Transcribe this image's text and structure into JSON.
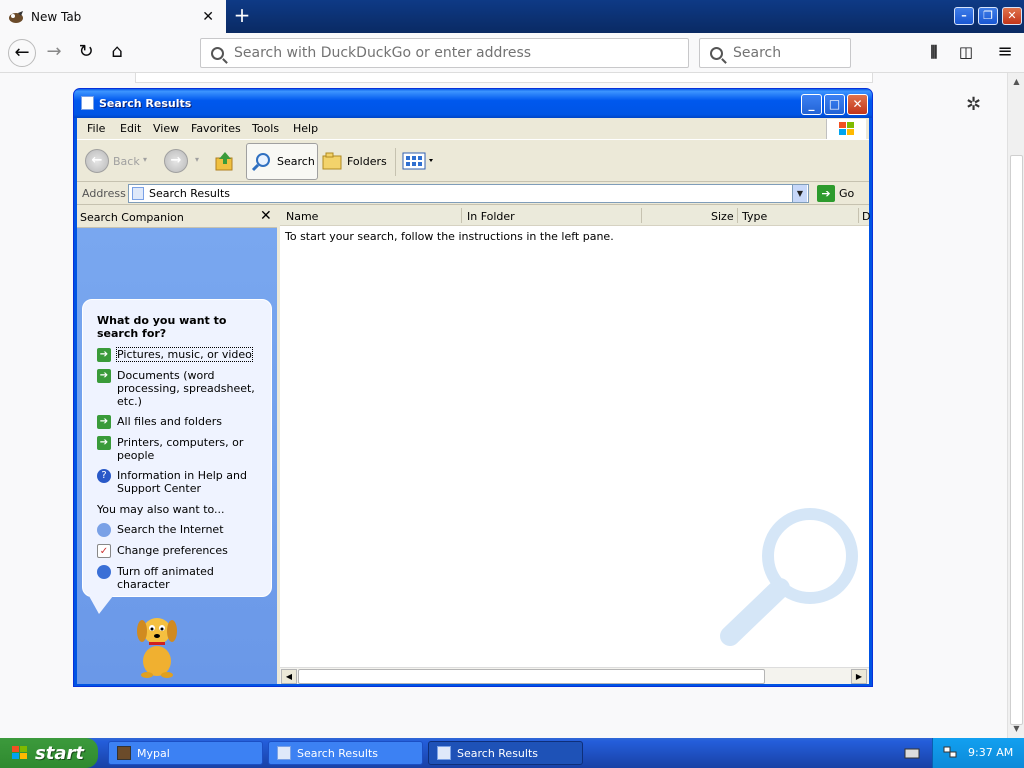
{
  "browser": {
    "tab_title": "New Tab",
    "url_placeholder": "Search with DuckDuckGo or enter address",
    "search_placeholder": "Search"
  },
  "window": {
    "title": "Search Results",
    "menu": [
      "File",
      "Edit",
      "View",
      "Favorites",
      "Tools",
      "Help"
    ],
    "toolbar": {
      "back": "Back",
      "search": "Search",
      "folders": "Folders"
    },
    "address_label": "Address",
    "address_value": "Search Results",
    "go_label": "Go"
  },
  "companion": {
    "header": "Search Companion",
    "question": "What do you want to search for?",
    "options": [
      "Pictures, music, or video",
      "Documents (word processing, spreadsheet, etc.)",
      "All files and folders",
      "Printers, computers, or people",
      "Information in Help and Support Center"
    ],
    "also_label": "You may also want to...",
    "also_options": [
      "Search the Internet",
      "Change preferences",
      "Turn off animated character"
    ]
  },
  "results": {
    "columns": [
      "Name",
      "In Folder",
      "Size",
      "Type",
      "D"
    ],
    "empty_message": "To start your search, follow the instructions in the left pane."
  },
  "taskbar": {
    "start": "start",
    "tasks": [
      "Mypal",
      "Search Results",
      "Search Results"
    ],
    "clock": "9:37 AM"
  }
}
